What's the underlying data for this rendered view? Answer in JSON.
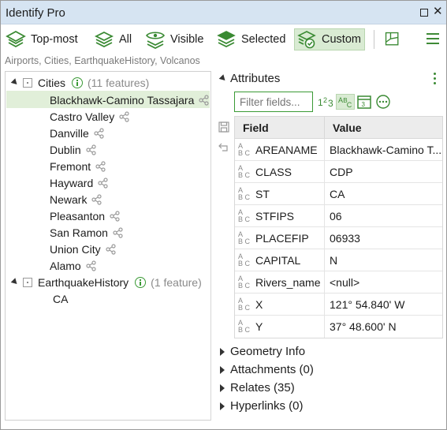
{
  "window": {
    "title": "Identify Pro"
  },
  "toolbar": {
    "top_most": "Top-most",
    "all": "All",
    "visible": "Visible",
    "selected": "Selected",
    "custom": "Custom"
  },
  "layers_text": "Airports, Cities, EarthquakeHistory, Volcanos",
  "tree": {
    "cities": {
      "label": "Cities",
      "count": "(11 features)"
    },
    "features": [
      "Blackhawk-Camino Tassajara",
      "Castro Valley",
      "Danville",
      "Dublin",
      "Fremont",
      "Hayward",
      "Newark",
      "Pleasanton",
      "San Ramon",
      "Union City",
      "Alamo"
    ],
    "quake": {
      "label": "EarthquakeHistory",
      "count": "(1 feature)",
      "child": "CA"
    }
  },
  "attributes": {
    "header": "Attributes",
    "filter_placeholder": "Filter fields...",
    "col_field": "Field",
    "col_value": "Value",
    "rows": [
      {
        "field": "AREANAME",
        "value": "Blackhawk-Camino T..."
      },
      {
        "field": "CLASS",
        "value": "CDP"
      },
      {
        "field": "ST",
        "value": "CA"
      },
      {
        "field": "STFIPS",
        "value": "06"
      },
      {
        "field": "PLACEFIP",
        "value": "06933"
      },
      {
        "field": "CAPITAL",
        "value": "N"
      },
      {
        "field": "Rivers_name",
        "value": "<null>"
      },
      {
        "field": "X",
        "value": "121° 54.840' W"
      },
      {
        "field": "Y",
        "value": "37° 48.600' N"
      }
    ]
  },
  "sections": {
    "geometry": "Geometry Info",
    "attachments": "Attachments (0)",
    "relates": "Relates (35)",
    "hyperlinks": "Hyperlinks (0)"
  },
  "colors": {
    "accent": "#3a9a35",
    "selection": "#e1efd9",
    "titlebar": "#d6e4f2"
  }
}
